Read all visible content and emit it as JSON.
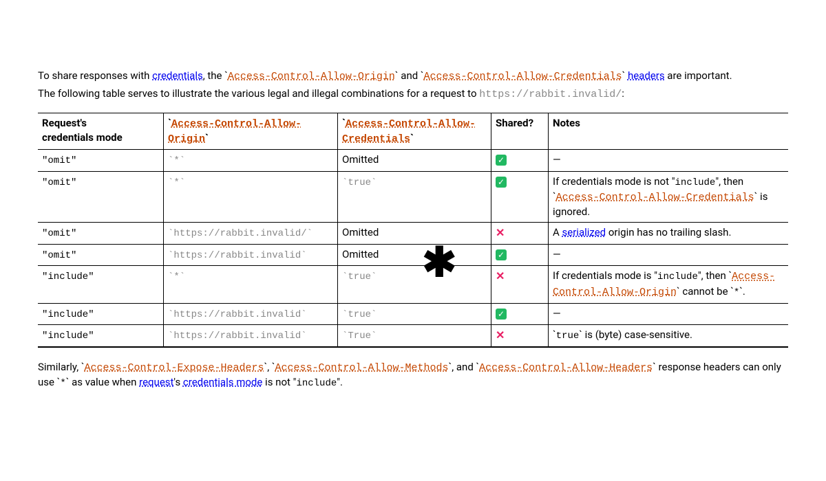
{
  "intro": {
    "p1_a": "To share responses with ",
    "p1_link_credentials": "credentials",
    "p1_b": ", the `",
    "p1_hdr1": "Access-Control-Allow-Origin",
    "p1_c": "` and `",
    "p1_hdr2": "Access-Control-Allow-Credentials",
    "p1_d": "` ",
    "p1_link_headers": "headers",
    "p1_e": " are important.",
    "p2_a": "The following table serves to illustrate the various legal and illegal combinations for a request to ",
    "p2_url": "https://rabbit.invalid/",
    "p2_b": ":"
  },
  "table": {
    "headers": {
      "mode_a": "Request's",
      "mode_b": "credentials mode",
      "origin": "Access-Control-Allow-Origin",
      "cred": "Access-Control-Allow-Credentials",
      "shared": "Shared?",
      "notes": "Notes"
    },
    "rows": [
      {
        "mode": "\"omit\"",
        "origin": "`*`",
        "cred": "Omitted",
        "shared": "yes",
        "note_type": "dash"
      },
      {
        "mode": "\"omit\"",
        "origin": "`*`",
        "cred": "`true`",
        "shared": "yes",
        "note_type": "text_hdr",
        "note_a": "If credentials mode is not \"",
        "note_code1": "include",
        "note_b": "\", then `",
        "note_hdr": "Access-Control-Allow-Credentials",
        "note_c": "` is ignored."
      },
      {
        "mode": "\"omit\"",
        "origin": "`https://rabbit.invalid/`",
        "cred": "Omitted",
        "shared": "no",
        "note_type": "text_link",
        "note_a": "A ",
        "note_link": "serialized",
        "note_b": " origin has no trailing slash."
      },
      {
        "mode": "\"omit\"",
        "origin": "`https://rabbit.invalid`",
        "cred": "Omitted",
        "shared": "yes",
        "note_type": "dash"
      },
      {
        "mode": "\"include\"",
        "origin": "`*`",
        "cred": "`true`",
        "shared": "no",
        "note_type": "text_hdr2",
        "note_a": "If credentials mode is \"",
        "note_code1": "include",
        "note_b": "\", then `",
        "note_hdr": "Access-Control-Allow-Origin",
        "note_c": "` cannot be `",
        "note_code2": "*",
        "note_d": "`."
      },
      {
        "mode": "\"include\"",
        "origin": "`https://rabbit.invalid`",
        "cred": "`true`",
        "shared": "yes",
        "note_type": "dash"
      },
      {
        "mode": "\"include\"",
        "origin": "`https://rabbit.invalid`",
        "cred": "`True`",
        "shared": "no",
        "note_type": "text_code",
        "note_a": "`",
        "note_code1": "true",
        "note_b": "` is (byte) case-sensitive."
      }
    ]
  },
  "outro": {
    "a": "Similarly, `",
    "h1": "Access-Control-Expose-Headers",
    "b": "`, `",
    "h2": "Access-Control-Allow-Methods",
    "c": "`, and `",
    "h3": "Access-Control-Allow-Headers",
    "d": "` response headers can only use `",
    "star": "*",
    "e": "` as value when ",
    "link_request": "request",
    "f": "'s ",
    "link_credmode": "credentials mode",
    "g": " is not \"",
    "include": "include",
    "h": "\"."
  }
}
